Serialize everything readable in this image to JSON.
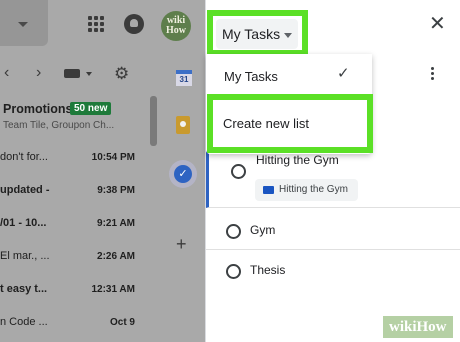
{
  "header": {
    "avatar_top": "wiki",
    "avatar_bottom": "How"
  },
  "toolbar": {
    "prev_icon": "‹",
    "next_icon": "›"
  },
  "promotions": {
    "title": "Promotions",
    "badge": "50 new",
    "subtitle": "Team Tile, Groupon Ch..."
  },
  "mail_rows": [
    {
      "subject": "don't for...",
      "date": "10:54 PM",
      "bold": false
    },
    {
      "subject": "updated -",
      "date": "9:38 PM",
      "bold": true
    },
    {
      "subject": "/01 - 10...",
      "date": "9:21 AM",
      "bold": true
    },
    {
      "subject": "El mar., ...",
      "date": "2:26 AM",
      "bold": false
    },
    {
      "subject": "t easy t...",
      "date": "12:31 AM",
      "bold": true
    },
    {
      "subject": "n Code ...",
      "date": "Oct 9",
      "bold": false
    }
  ],
  "side_strip": {
    "calendar_label": "31",
    "add_label": "+"
  },
  "tasks_panel": {
    "list_selector": "My Tasks",
    "close_label": "✕",
    "menu": {
      "current_list": "My Tasks",
      "check": "✓",
      "create_new": "Create new list"
    },
    "tasks": [
      {
        "title": "Hitting the Gym",
        "chip": "Hitting the Gym"
      },
      {
        "title": "Gym"
      },
      {
        "title": "Thesis"
      }
    ]
  },
  "watermark": "wikiHow",
  "colors": {
    "highlight": "#5be026",
    "accent_blue": "#2e63c2",
    "promo_badge": "#1e7a3a"
  }
}
